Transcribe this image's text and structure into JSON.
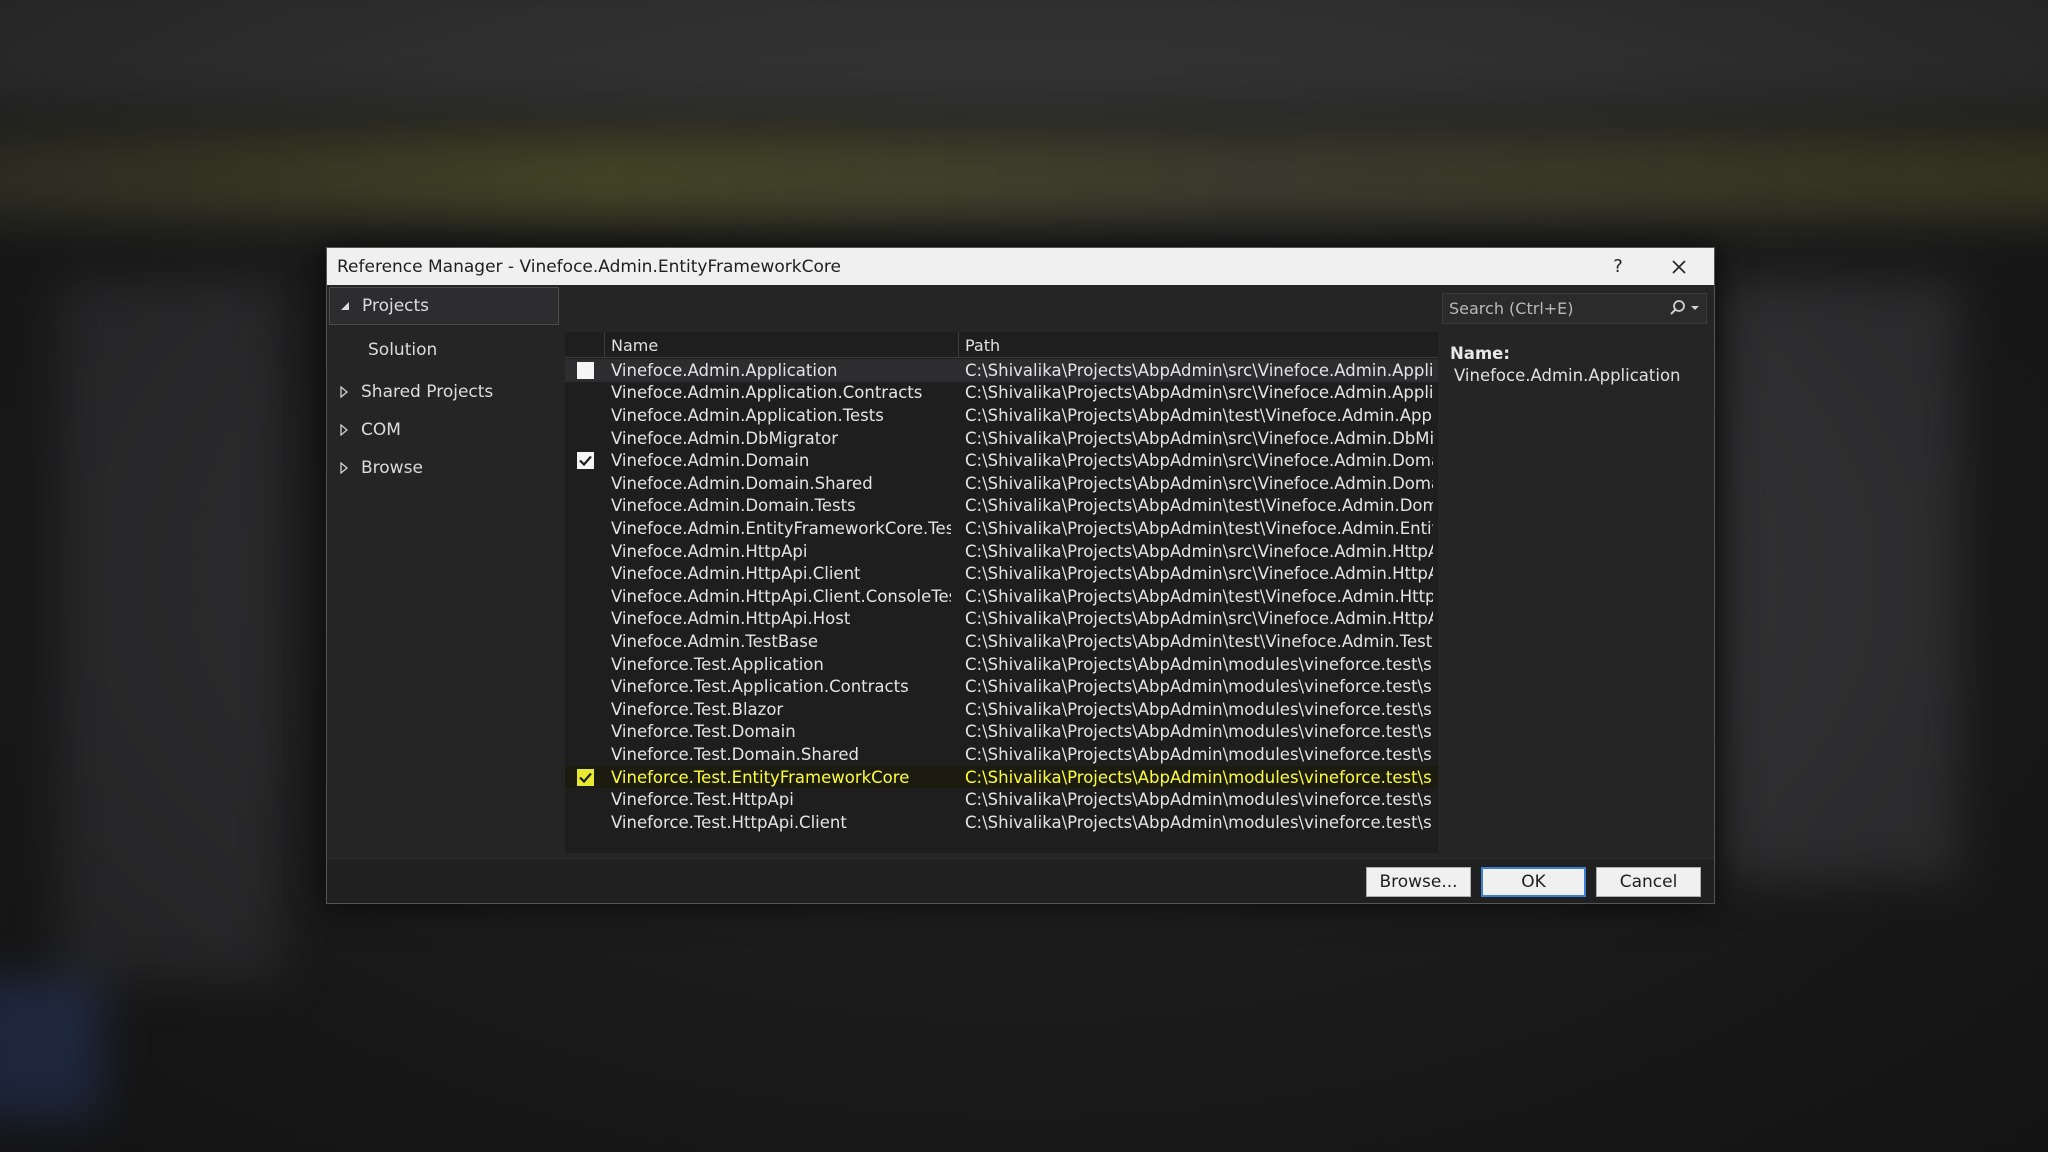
{
  "dialog": {
    "title": "Reference Manager - Vinefoce.Admin.EntityFrameworkCore",
    "help": "?"
  },
  "nav": {
    "projects": "Projects",
    "solution": "Solution",
    "shared_projects": "Shared Projects",
    "com": "COM",
    "browse": "Browse"
  },
  "search": {
    "placeholder": "Search (Ctrl+E)"
  },
  "grid": {
    "col_name": "Name",
    "col_path": "Path",
    "rows": [
      {
        "name": "Vinefoce.Admin.Application",
        "path": "C:\\Shivalika\\Projects\\AbpAdmin\\src\\Vinefoce.Admin.Appli...",
        "checked": false
      },
      {
        "name": "Vinefoce.Admin.Application.Contracts",
        "path": "C:\\Shivalika\\Projects\\AbpAdmin\\src\\Vinefoce.Admin.Appli...",
        "checked": false
      },
      {
        "name": "Vinefoce.Admin.Application.Tests",
        "path": "C:\\Shivalika\\Projects\\AbpAdmin\\test\\Vinefoce.Admin.Appli...",
        "checked": false
      },
      {
        "name": "Vinefoce.Admin.DbMigrator",
        "path": "C:\\Shivalika\\Projects\\AbpAdmin\\src\\Vinefoce.Admin.DbMi...",
        "checked": false
      },
      {
        "name": "Vinefoce.Admin.Domain",
        "path": "C:\\Shivalika\\Projects\\AbpAdmin\\src\\Vinefoce.Admin.Doma...",
        "checked": true
      },
      {
        "name": "Vinefoce.Admin.Domain.Shared",
        "path": "C:\\Shivalika\\Projects\\AbpAdmin\\src\\Vinefoce.Admin.Doma...",
        "checked": false
      },
      {
        "name": "Vinefoce.Admin.Domain.Tests",
        "path": "C:\\Shivalika\\Projects\\AbpAdmin\\test\\Vinefoce.Admin.Dom...",
        "checked": false
      },
      {
        "name": "Vinefoce.Admin.EntityFrameworkCore.Tests",
        "path": "C:\\Shivalika\\Projects\\AbpAdmin\\test\\Vinefoce.Admin.Entit...",
        "checked": false
      },
      {
        "name": "Vinefoce.Admin.HttpApi",
        "path": "C:\\Shivalika\\Projects\\AbpAdmin\\src\\Vinefoce.Admin.HttpA...",
        "checked": false
      },
      {
        "name": "Vinefoce.Admin.HttpApi.Client",
        "path": "C:\\Shivalika\\Projects\\AbpAdmin\\src\\Vinefoce.Admin.HttpA...",
        "checked": false
      },
      {
        "name": "Vinefoce.Admin.HttpApi.Client.ConsoleTes...",
        "path": "C:\\Shivalika\\Projects\\AbpAdmin\\test\\Vinefoce.Admin.Http...",
        "checked": false
      },
      {
        "name": "Vinefoce.Admin.HttpApi.Host",
        "path": "C:\\Shivalika\\Projects\\AbpAdmin\\src\\Vinefoce.Admin.HttpA...",
        "checked": false
      },
      {
        "name": "Vinefoce.Admin.TestBase",
        "path": "C:\\Shivalika\\Projects\\AbpAdmin\\test\\Vinefoce.Admin.TestB...",
        "checked": false
      },
      {
        "name": "Vineforce.Test.Application",
        "path": "C:\\Shivalika\\Projects\\AbpAdmin\\modules\\vineforce.test\\sr...",
        "checked": false
      },
      {
        "name": "Vineforce.Test.Application.Contracts",
        "path": "C:\\Shivalika\\Projects\\AbpAdmin\\modules\\vineforce.test\\sr...",
        "checked": false
      },
      {
        "name": "Vineforce.Test.Blazor",
        "path": "C:\\Shivalika\\Projects\\AbpAdmin\\modules\\vineforce.test\\sr...",
        "checked": false
      },
      {
        "name": "Vineforce.Test.Domain",
        "path": "C:\\Shivalika\\Projects\\AbpAdmin\\modules\\vineforce.test\\sr...",
        "checked": false
      },
      {
        "name": "Vineforce.Test.Domain.Shared",
        "path": "C:\\Shivalika\\Projects\\AbpAdmin\\modules\\vineforce.test\\sr...",
        "checked": false
      },
      {
        "name": "Vineforce.Test.EntityFrameworkCore",
        "path": "C:\\Shivalika\\Projects\\AbpAdmin\\modules\\vineforce.test\\sr...",
        "checked": true
      },
      {
        "name": "Vineforce.Test.HttpApi",
        "path": "C:\\Shivalika\\Projects\\AbpAdmin\\modules\\vineforce.test\\sr...",
        "checked": false
      },
      {
        "name": "Vineforce.Test.HttpApi.Client",
        "path": "C:\\Shivalika\\Projects\\AbpAdmin\\modules\\vineforce.test\\sr...",
        "checked": false
      }
    ]
  },
  "details": {
    "name_label": "Name:",
    "name_value": "Vinefoce.Admin.Application"
  },
  "buttons": {
    "browse": "Browse...",
    "ok": "OK",
    "cancel": "Cancel"
  },
  "colors": {
    "highlight_text": "#ffff33",
    "ok_border": "#3c7fd0"
  }
}
